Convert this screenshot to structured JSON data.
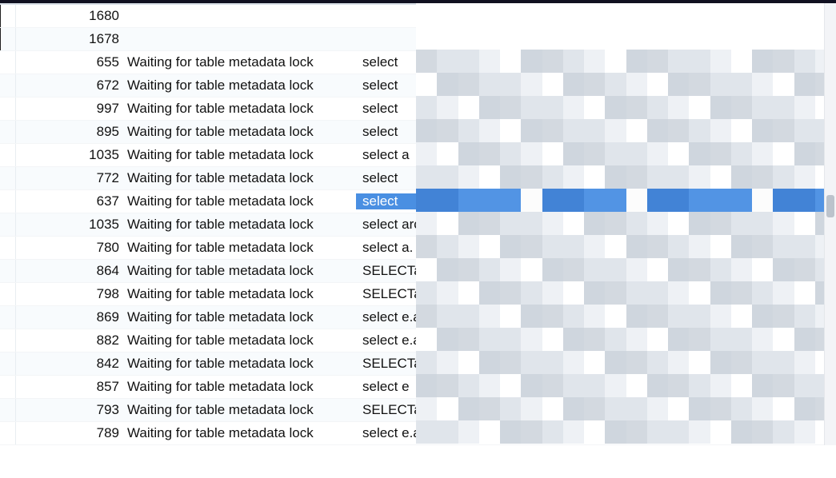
{
  "rows": [
    {
      "num": 1680,
      "state": "",
      "query": ""
    },
    {
      "num": 1678,
      "state": "",
      "query": ""
    },
    {
      "num": 655,
      "state": "Waiting for table metadata lock",
      "query": "select"
    },
    {
      "num": 672,
      "state": "Waiting for table metadata lock",
      "query": "select"
    },
    {
      "num": 997,
      "state": "Waiting for table metadata lock",
      "query": "select"
    },
    {
      "num": 895,
      "state": "Waiting for table metadata lock",
      "query": "select"
    },
    {
      "num": 1035,
      "state": "Waiting for table metadata lock",
      "query": "select a"
    },
    {
      "num": 772,
      "state": "Waiting for table metadata lock",
      "query": "select"
    },
    {
      "num": 637,
      "state": "Waiting for table metadata lock",
      "query": "select",
      "selected": true
    },
    {
      "num": 1035,
      "state": "Waiting for table metadata lock",
      "query": "select arca"
    },
    {
      "num": 780,
      "state": "Waiting for table metadata lock",
      "query": "select   a."
    },
    {
      "num": 864,
      "state": "Waiting for table metadata lock",
      "query": "SELECTa.i"
    },
    {
      "num": 798,
      "state": "Waiting for table metadata lock",
      "query": "SELECTa.i"
    },
    {
      "num": 869,
      "state": "Waiting for table metadata lock",
      "query": "select e.a"
    },
    {
      "num": 882,
      "state": "Waiting for table metadata lock",
      "query": "select e.a"
    },
    {
      "num": 842,
      "state": "Waiting for table metadata lock",
      "query": "SELECTa"
    },
    {
      "num": 857,
      "state": "Waiting for table metadata lock",
      "query": "select e"
    },
    {
      "num": 793,
      "state": "Waiting for table metadata lock",
      "query": "SELECTa"
    },
    {
      "num": 789,
      "state": "Waiting for table metadata lock",
      "query": "select e.a"
    }
  ],
  "columns": {
    "num_width": 135,
    "state_width": 290
  },
  "colors": {
    "selection": "#4a8fe2",
    "alt_row": "#f8fbfd"
  }
}
